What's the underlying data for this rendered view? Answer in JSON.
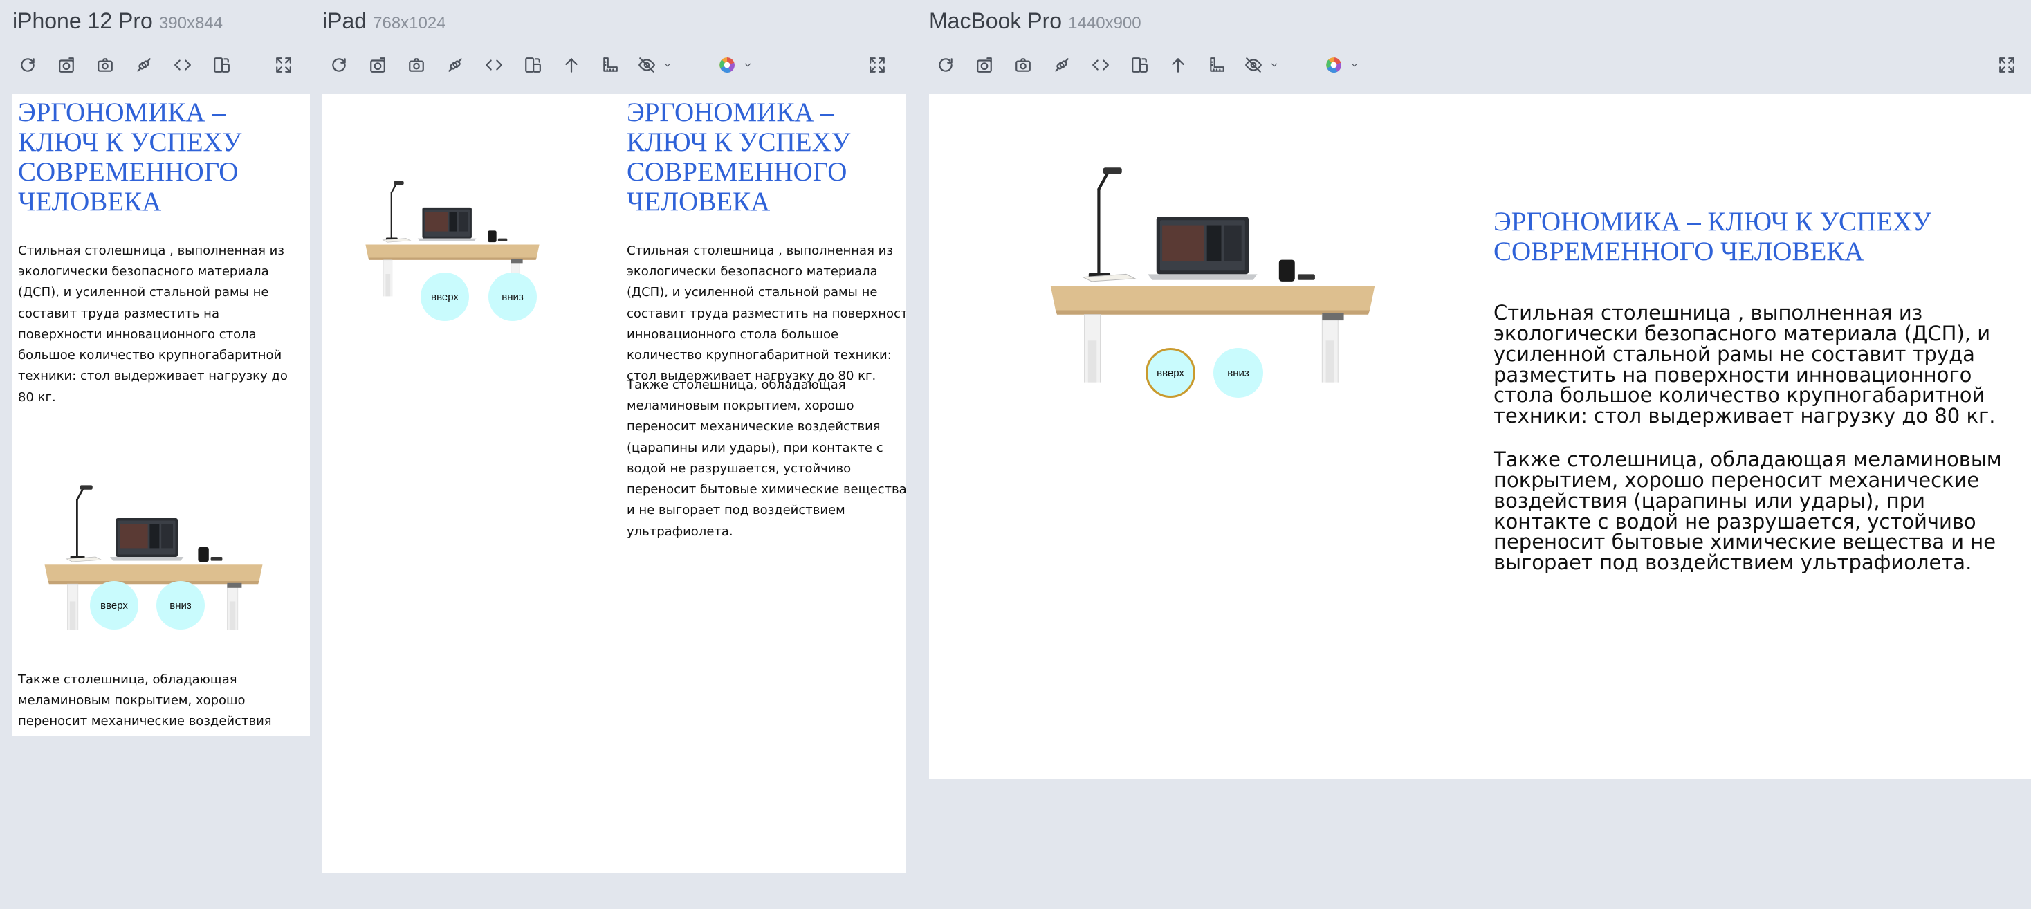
{
  "content": {
    "heading": "ЭРГОНОМИКА – КЛЮЧ К УСПЕХУ СОВРЕМЕННОГО ЧЕЛОВЕКА",
    "paragraph_1": "Стильная столешница , выполненная из экологически безопасного материала (ДСП), и усиленной стальной рамы не составит труда разместить на поверхности инновационного стола большое количество крупногабаритной техники: стол выдерживает нагрузку до 80 кг.",
    "paragraph_2": "Также столешница, обладающая меламиновым покрытием, хорошо переносит механические воздействия (царапины или удары), при контакте с водой не разрушается, устойчиво переносит бытовые химические вещества и не выгорает под воздействием ультрафиолета.",
    "button_up": "вверх",
    "button_down": "вниз"
  },
  "devices": [
    {
      "name": "iPhone 12 Pro",
      "size": "390x844"
    },
    {
      "name": "iPad",
      "size": "768x1024"
    },
    {
      "name": "MacBook Pro",
      "size": "1440x900"
    }
  ],
  "icons": {
    "reload": "reload-icon",
    "screenshot_full": "screenshot-full-icon",
    "screenshot": "camera-icon",
    "sync": "sync-icon",
    "inspect": "code-icon",
    "rotate": "rotate-icon",
    "scroll_top": "arrow-up-icon",
    "ruler": "ruler-icon",
    "visibility": "eye-off-icon",
    "color": "color-wheel-icon",
    "fullscreen": "fullscreen-icon"
  },
  "colors": {
    "heading": "#2f62d8",
    "button_bg": "#c9fbfd",
    "active_ring": "#c99a2e",
    "background": "#e2e6ed"
  }
}
